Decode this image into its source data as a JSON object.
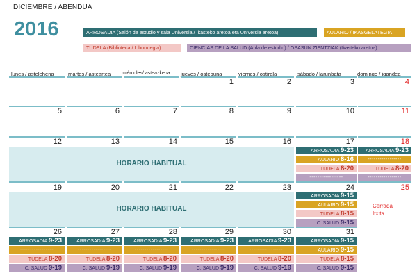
{
  "header": {
    "month": "DICIEMBRE / ABENDUA",
    "year": "2016"
  },
  "legend": {
    "arrosadia": "ARROSADIA (Salón de estudio y sala Universia / Ikasteko aretoa eta Universia aretoa)",
    "aulario": "AULARIO / IKASGELATEGIA",
    "tudela": "TUDELA (Biblioteca / Liburutegia)",
    "csalud": "CIENCIAS DE LA SALUD (Aula de estudio) / OSASUN ZIENTZIAK (Ikasteko aretoa)"
  },
  "weekdays": [
    "lunes / astelehena",
    "martes / asteartea",
    "miércoles/ asteazkena",
    "jueves / osteguna",
    "viernes / ostirala",
    "sábado / larunbata",
    "domingo / igandea"
  ],
  "days": {
    "w1": [
      "",
      "",
      "",
      "1",
      "2",
      "3",
      "4"
    ],
    "w2": [
      "5",
      "6",
      "7",
      "8",
      "9",
      "10",
      "11"
    ],
    "w3": [
      "12",
      "13",
      "14",
      "15",
      "16",
      "17",
      "18"
    ],
    "w4": [
      "19",
      "20",
      "21",
      "22",
      "23",
      "24",
      "25"
    ],
    "w5": [
      "26",
      "27",
      "28",
      "29",
      "30",
      "31"
    ]
  },
  "habitual": "HORARIO HABITUAL",
  "labels": {
    "arrosadia": "ARROSADIA",
    "aulario": "AULARIO",
    "tudela": "TUDELA",
    "csalud": "C. SALUD",
    "dashes": "-----------------"
  },
  "hours": {
    "h923": "9-23",
    "h816": "8-16",
    "h820": "8-20",
    "h915": "9-15",
    "h815": "8-15",
    "h919": "9-19"
  },
  "closed": {
    "line1": "Cerrada",
    "line2": "Itxita"
  },
  "colors": {
    "arrosadia": "#2e6e73",
    "aulario": "#d9a423",
    "tudela": "#f3c8c6",
    "csalud": "#b7a0c0",
    "accent": "#7cbdc8",
    "sunday": "#e02020"
  }
}
